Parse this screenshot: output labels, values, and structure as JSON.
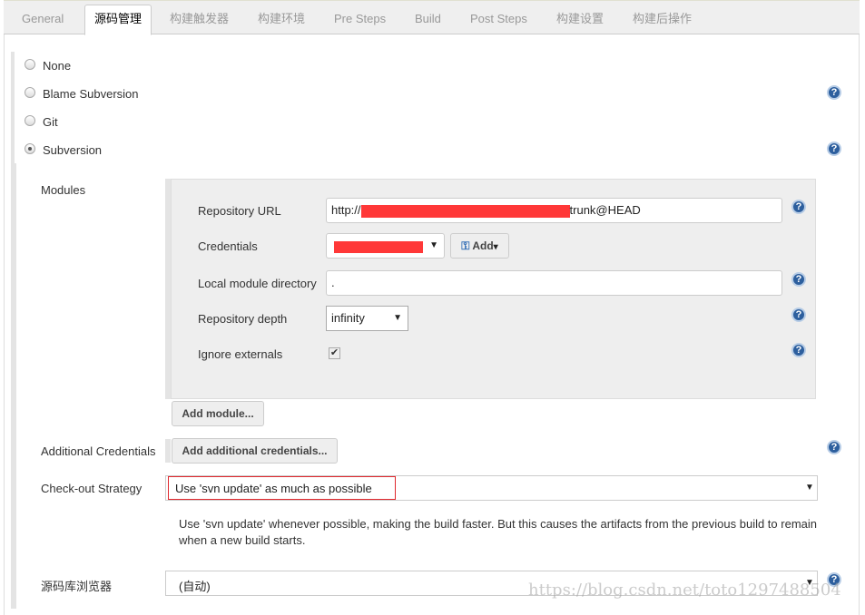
{
  "tabs": [
    {
      "label": "General"
    },
    {
      "label": "源码管理",
      "active": true
    },
    {
      "label": "构建触发器"
    },
    {
      "label": "构建环境"
    },
    {
      "label": "Pre Steps"
    },
    {
      "label": "Build"
    },
    {
      "label": "Post Steps"
    },
    {
      "label": "构建设置"
    },
    {
      "label": "构建后操作"
    }
  ],
  "scm": {
    "options": [
      {
        "label": "None",
        "selected": false
      },
      {
        "label": "Blame Subversion",
        "selected": false
      },
      {
        "label": "Git",
        "selected": false
      },
      {
        "label": "Subversion",
        "selected": true
      }
    ]
  },
  "modules": {
    "label": "Modules",
    "repo_url_label": "Repository URL",
    "repo_url_prefix": "http://",
    "repo_url_suffix": "trunk@HEAD",
    "credentials_label": "Credentials",
    "add_label": "Add",
    "local_dir_label": "Local module directory",
    "local_dir_value": ".",
    "depth_label": "Repository depth",
    "depth_value": "infinity",
    "ignore_label": "Ignore externals",
    "ignore_checked": true,
    "add_module": "Add module..."
  },
  "additional": {
    "label": "Additional Credentials",
    "button": "Add additional credentials..."
  },
  "checkout": {
    "label": "Check-out Strategy",
    "value": "Use 'svn update' as much as possible",
    "description": "Use 'svn update' whenever possible, making the build faster. But this causes the artifacts from the previous build to remain when a new build starts."
  },
  "browser": {
    "label": "源码库浏览器",
    "value": "(自动)"
  },
  "watermark": "https://blog.csdn.net/toto1297488504",
  "colors": {
    "help": "#2d5f9e",
    "redaction": "#ff3838",
    "highlight": "#e0282e"
  }
}
